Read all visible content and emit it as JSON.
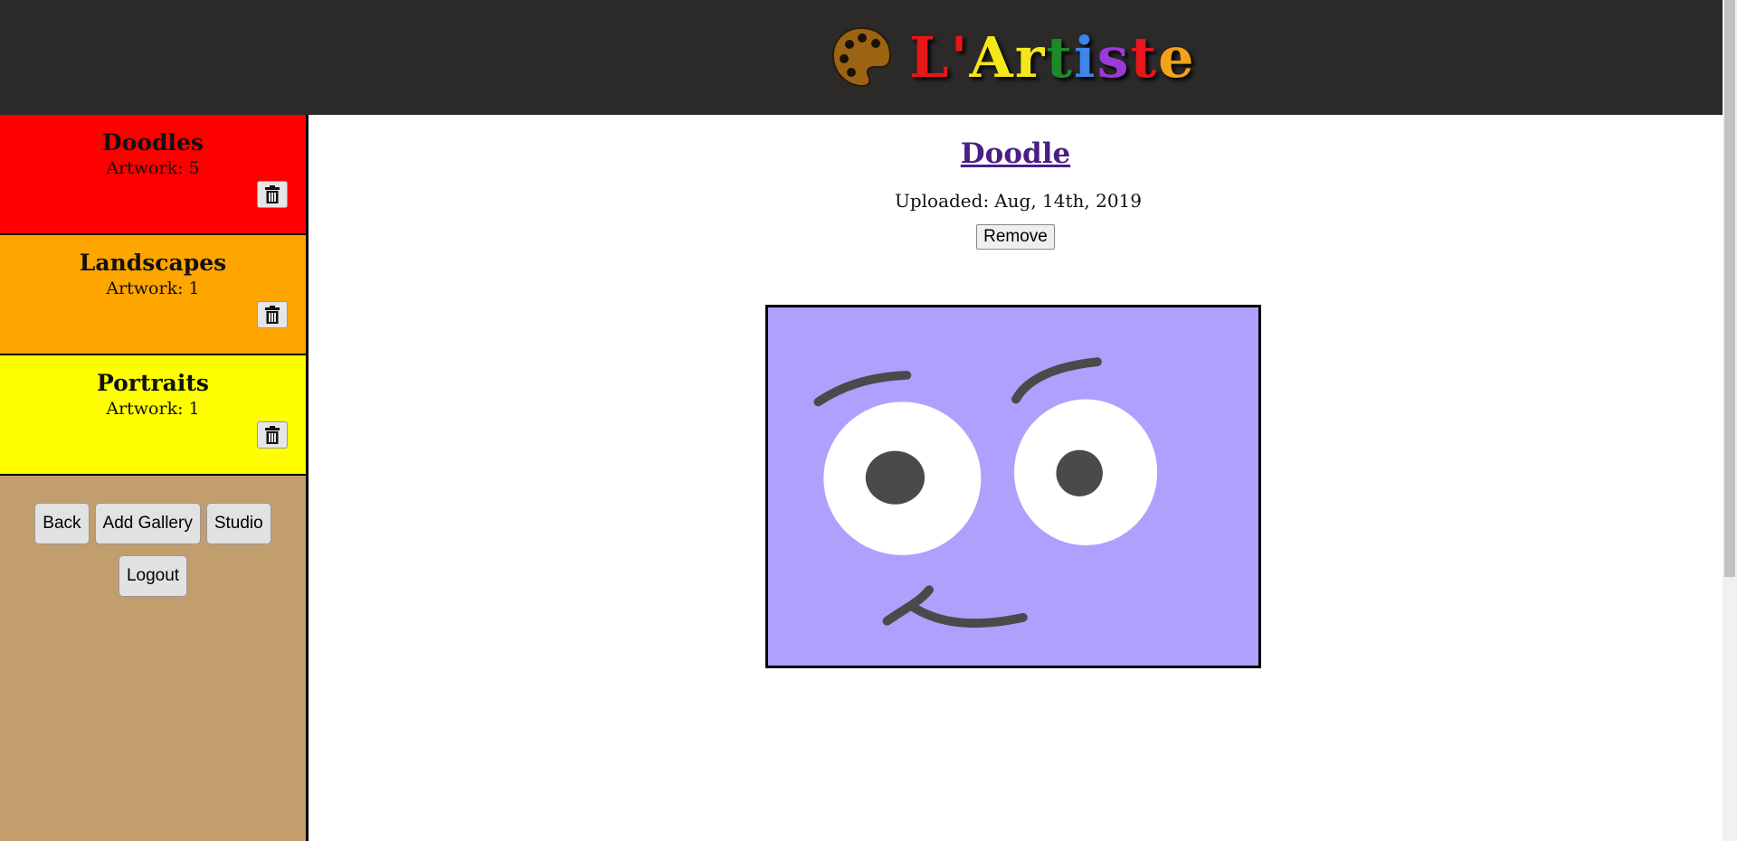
{
  "header": {
    "logo_letters": [
      {
        "char": "L",
        "color": "#e8151b"
      },
      {
        "char": "'",
        "color": "#e8151b"
      },
      {
        "char": "A",
        "color": "#f5e61a"
      },
      {
        "char": "r",
        "color": "#f5e61a"
      },
      {
        "char": "t",
        "color": "#1d8a2a"
      },
      {
        "char": "i",
        "color": "#3d85e8"
      },
      {
        "char": "s",
        "color": "#9a3ad8"
      },
      {
        "char": "t",
        "color": "#e8151b"
      },
      {
        "char": "e",
        "color": "#f5a11a"
      }
    ],
    "logo_icon": "palette-icon",
    "background_color": "#2b2a29"
  },
  "sidebar": {
    "galleries": [
      {
        "name": "Doodles",
        "count": "Artwork: 5",
        "color": "#ff0000"
      },
      {
        "name": "Landscapes",
        "count": "Artwork: 1",
        "color": "#ffa500"
      },
      {
        "name": "Portraits",
        "count": "Artwork: 1",
        "color": "#ffff00"
      }
    ],
    "delete_icon": "trash-icon",
    "buttons": {
      "back": "Back",
      "add_gallery": "Add Gallery",
      "studio": "Studio",
      "logout": "Logout"
    }
  },
  "main": {
    "title": "Doodle",
    "uploaded_label": "Uploaded:",
    "uploaded_date": "Aug, 14th, 2019",
    "remove_label": "Remove",
    "artwork_background": "#aea0fd"
  }
}
